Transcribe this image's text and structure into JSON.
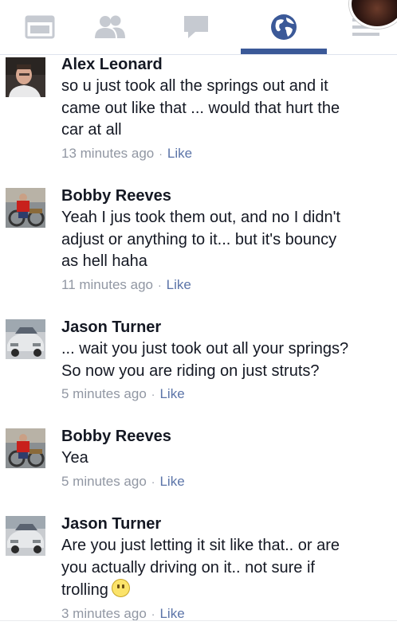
{
  "nav": {
    "tabs": [
      {
        "icon": "news-feed-icon",
        "active": false
      },
      {
        "icon": "friends-icon",
        "active": false
      },
      {
        "icon": "messages-icon",
        "active": false
      },
      {
        "icon": "notifications-globe-icon",
        "active": true
      },
      {
        "icon": "menu-icon",
        "active": false
      }
    ],
    "colors": {
      "icon": "#c6cad1",
      "active": "#3b5998",
      "underline": "#3b5998"
    }
  },
  "comments": [
    {
      "author": "Alex Leonard",
      "text": [
        "so u just took all the springs out and it",
        "came out like that ... would that hurt the",
        "car at all"
      ],
      "time": "13 minutes ago",
      "separator": "·",
      "like": "Like",
      "avatar": "person-photo"
    },
    {
      "author": "Bobby Reeves",
      "text": [
        "Yeah I jus took them out, and no I didn't",
        "adjust or anything to it... but it's bouncy",
        "as hell haha"
      ],
      "time": "11 minutes ago",
      "separator": "·",
      "like": "Like",
      "avatar": "person-on-bike-photo"
    },
    {
      "author": "Jason Turner",
      "text": [
        "... wait you just took out all your springs?",
        "So now you are riding on just struts?"
      ],
      "time": "5 minutes ago",
      "separator": "·",
      "like": "Like",
      "avatar": "silver-car-photo"
    },
    {
      "author": "Bobby Reeves",
      "text": [
        "Yea"
      ],
      "time": "5 minutes ago",
      "separator": "·",
      "like": "Like",
      "avatar": "person-on-bike-photo"
    },
    {
      "author": "Jason Turner",
      "text": [
        "Are you just letting it sit like that.. or are",
        "you actually driving on it.. not sure if",
        "trolling"
      ],
      "time": "3 minutes ago",
      "separator": "·",
      "like": "Like",
      "avatar": "silver-car-photo",
      "emoji": "smile-emoji-icon"
    }
  ]
}
